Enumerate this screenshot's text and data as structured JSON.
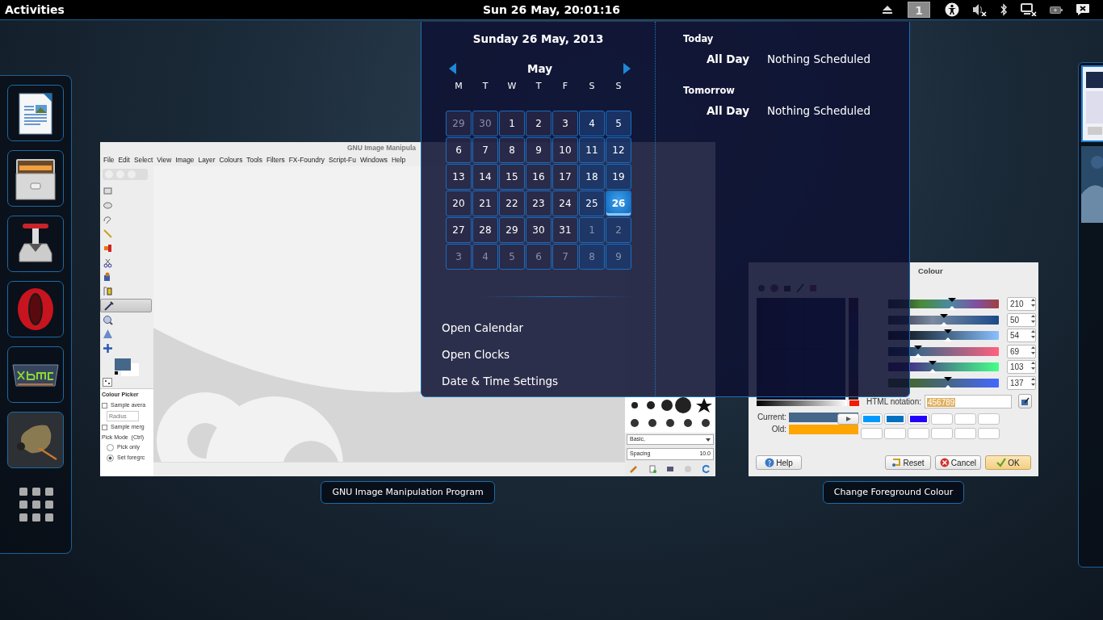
{
  "top_bar": {
    "activities": "Activities",
    "clock": "Sun 26 May, 20:01:16",
    "workspace": "1"
  },
  "dock": {
    "apps": [
      {
        "kind": "writer"
      },
      {
        "kind": "files"
      },
      {
        "kind": "transmission"
      },
      {
        "kind": "opera"
      },
      {
        "kind": "xbmc"
      },
      {
        "kind": "gimp"
      }
    ]
  },
  "gimp_window": {
    "title": "GNU Image Manipula",
    "menu": [
      "File",
      "Edit",
      "Select",
      "View",
      "Image",
      "Layer",
      "Colours",
      "Tools",
      "Filters",
      "FX-Foundry",
      "Script-Fu",
      "Windows",
      "Help"
    ],
    "tools": [
      {
        "selected": false
      },
      {
        "selected": false
      },
      {
        "selected": false
      },
      {
        "selected": false
      },
      {
        "selected": false
      },
      {
        "selected": false
      },
      {
        "selected": false
      },
      {
        "selected": false
      },
      {
        "selected": true
      },
      {
        "selected": false
      },
      {
        "selected": false
      },
      {
        "selected": false
      }
    ],
    "tool_options": {
      "title": "Colour Picker",
      "checks": [
        {
          "label": "Sample avera",
          "checked": false
        },
        {
          "label": "Sample merg",
          "checked": false
        }
      ],
      "radius_placeholder": "Radius",
      "pick_mode": "Pick Mode  (Ctrl)",
      "modes": [
        {
          "label": "Pick only",
          "selected": false
        },
        {
          "label": "Set foregrc",
          "selected": true
        }
      ]
    },
    "brushes": {
      "preset": "Basic,",
      "spacing_label": "Spacing",
      "spacing": "10.0"
    },
    "caption": "GNU Image Manipulation Program"
  },
  "colour_dialog": {
    "title": "Colour",
    "channels": [
      {
        "level": 0.58,
        "value": "210"
      },
      {
        "level": 0.5,
        "value": "50"
      },
      {
        "level": 0.54,
        "value": "54"
      },
      {
        "level": 0.27,
        "value": "69"
      },
      {
        "level": 0.4,
        "value": "103"
      },
      {
        "level": 0.54,
        "value": "137"
      }
    ],
    "html_label": "HTML notation:",
    "html_value": "456789",
    "current_label": "Current:",
    "old_label": "Old:",
    "history": [
      {
        "kind": "color",
        "color": "#0099ff"
      },
      {
        "kind": "color",
        "color": "#0070c0"
      },
      {
        "kind": "color",
        "color": "#2200ff"
      },
      {
        "kind": "empty"
      },
      {
        "kind": "empty"
      },
      {
        "kind": "empty"
      },
      {
        "kind": "empty"
      },
      {
        "kind": "empty"
      },
      {
        "kind": "empty"
      },
      {
        "kind": "empty"
      },
      {
        "kind": "empty"
      },
      {
        "kind": "empty"
      }
    ],
    "buttons": [
      {
        "label": "Help",
        "kind": "help"
      },
      {
        "label": "Reset",
        "kind": "reset"
      },
      {
        "label": "Cancel",
        "kind": "cancel"
      },
      {
        "label": "OK",
        "kind": "ok"
      }
    ],
    "caption": "Change Foreground Colour"
  },
  "calendar": {
    "date_heading": "Sunday 26 May, 2013",
    "month": "May",
    "weekdays": [
      "M",
      "T",
      "W",
      "T",
      "F",
      "S",
      "S"
    ],
    "weeks": [
      [
        {
          "day": "29",
          "other_month": true,
          "selected": false
        },
        {
          "day": "30",
          "other_month": true,
          "selected": false
        },
        {
          "day": "1",
          "other_month": false,
          "selected": false
        },
        {
          "day": "2",
          "other_month": false,
          "selected": false
        },
        {
          "day": "3",
          "other_month": false,
          "selected": false
        },
        {
          "day": "4",
          "other_month": false,
          "selected": false
        },
        {
          "day": "5",
          "other_month": false,
          "selected": false
        }
      ],
      [
        {
          "day": "6",
          "other_month": false,
          "selected": false
        },
        {
          "day": "7",
          "other_month": false,
          "selected": false
        },
        {
          "day": "8",
          "other_month": false,
          "selected": false
        },
        {
          "day": "9",
          "other_month": false,
          "selected": false
        },
        {
          "day": "10",
          "other_month": false,
          "selected": false
        },
        {
          "day": "11",
          "other_month": false,
          "selected": false
        },
        {
          "day": "12",
          "other_month": false,
          "selected": false
        }
      ],
      [
        {
          "day": "13",
          "other_month": false,
          "selected": false
        },
        {
          "day": "14",
          "other_month": false,
          "selected": false
        },
        {
          "day": "15",
          "other_month": false,
          "selected": false
        },
        {
          "day": "16",
          "other_month": false,
          "selected": false
        },
        {
          "day": "17",
          "other_month": false,
          "selected": false
        },
        {
          "day": "18",
          "other_month": false,
          "selected": false
        },
        {
          "day": "19",
          "other_month": false,
          "selected": false
        }
      ],
      [
        {
          "day": "20",
          "other_month": false,
          "selected": false
        },
        {
          "day": "21",
          "other_month": false,
          "selected": false
        },
        {
          "day": "22",
          "other_month": false,
          "selected": false
        },
        {
          "day": "23",
          "other_month": false,
          "selected": false
        },
        {
          "day": "24",
          "other_month": false,
          "selected": false
        },
        {
          "day": "25",
          "other_month": false,
          "selected": false
        },
        {
          "day": "26",
          "other_month": false,
          "selected": true
        }
      ],
      [
        {
          "day": "27",
          "other_month": false,
          "selected": false
        },
        {
          "day": "28",
          "other_month": false,
          "selected": false
        },
        {
          "day": "29",
          "other_month": false,
          "selected": false
        },
        {
          "day": "30",
          "other_month": false,
          "selected": false
        },
        {
          "day": "31",
          "other_month": false,
          "selected": false
        },
        {
          "day": "1",
          "other_month": true,
          "selected": false
        },
        {
          "day": "2",
          "other_month": true,
          "selected": false
        }
      ],
      [
        {
          "day": "3",
          "other_month": true,
          "selected": false
        },
        {
          "day": "4",
          "other_month": true,
          "selected": false
        },
        {
          "day": "5",
          "other_month": true,
          "selected": false
        },
        {
          "day": "6",
          "other_month": true,
          "selected": false
        },
        {
          "day": "7",
          "other_month": true,
          "selected": false
        },
        {
          "day": "8",
          "other_month": true,
          "selected": false
        },
        {
          "day": "9",
          "other_month": true,
          "selected": false
        }
      ]
    ],
    "actions": [
      "Open Calendar",
      "Open Clocks",
      "Date & Time Settings"
    ],
    "events": [
      {
        "heading": "Today",
        "time": "All Day",
        "text": "Nothing Scheduled"
      },
      {
        "heading": "Tomorrow",
        "time": "All Day",
        "text": "Nothing Scheduled"
      }
    ]
  },
  "workspaces": [
    {
      "selected": true
    },
    {
      "selected": false
    }
  ]
}
